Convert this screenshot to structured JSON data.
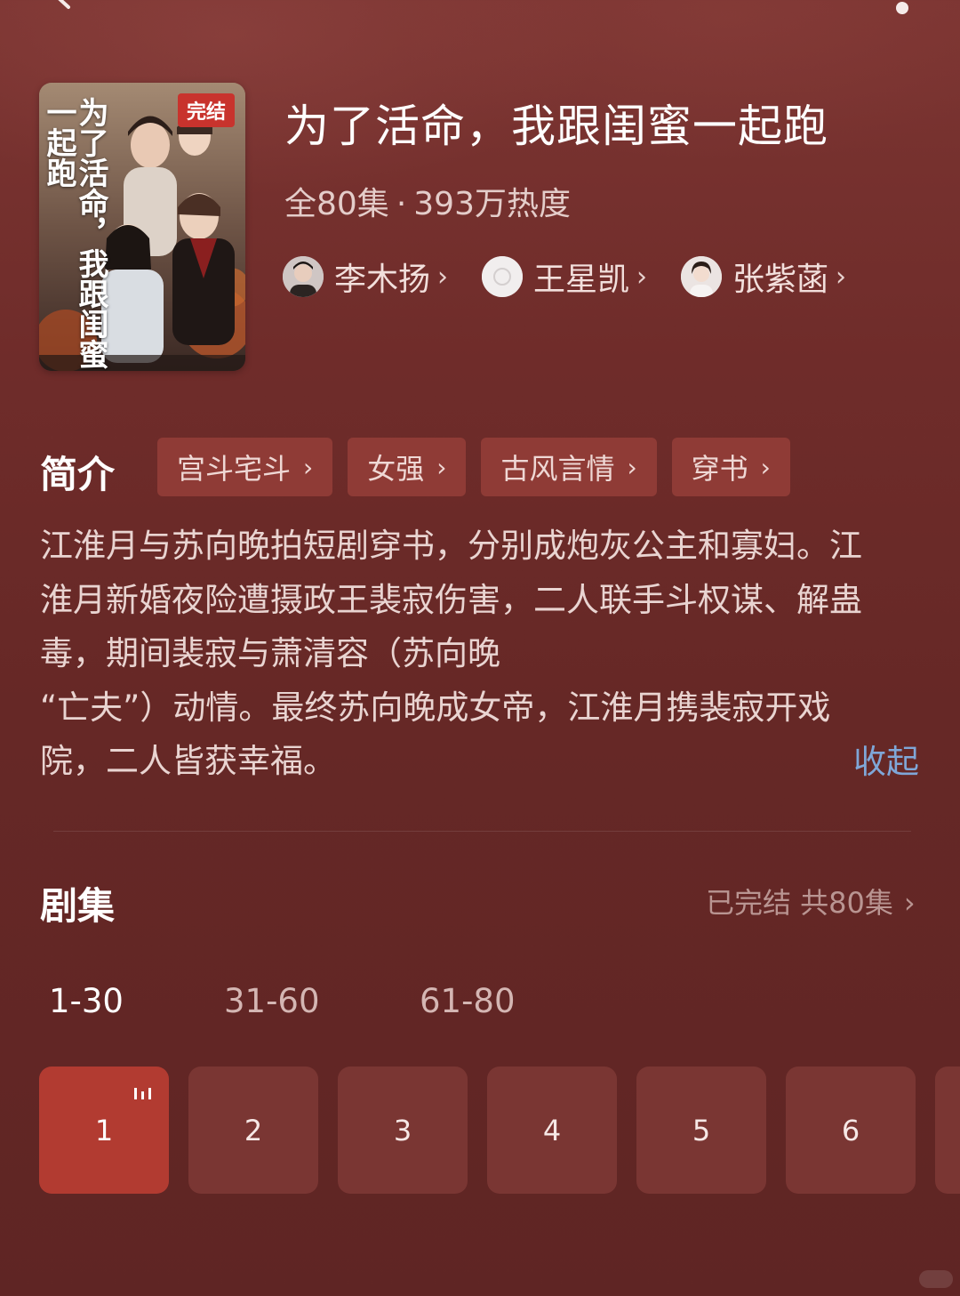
{
  "header": {
    "back_icon": "chevron-left-icon",
    "more_icon": "more-dots-icon"
  },
  "poster": {
    "badge": "完结",
    "title_art": "为了活命，我跟闺蜜一起跑"
  },
  "show": {
    "title": "为了活命，我跟闺蜜一起跑",
    "episodes_total": "全80集",
    "separator": "·",
    "popularity": "393万热度"
  },
  "actors": [
    {
      "name": "李木扬",
      "chevron": "›"
    },
    {
      "name": "王星凯",
      "chevron": "›"
    },
    {
      "name": "张紫菡",
      "chevron": "›"
    }
  ],
  "intro": {
    "label": "简介",
    "tags": [
      {
        "label": "宫斗宅斗",
        "chevron": "›"
      },
      {
        "label": "女强",
        "chevron": "›"
      },
      {
        "label": "古风言情",
        "chevron": "›"
      },
      {
        "label": "穿书",
        "chevron": "›"
      }
    ],
    "synopsis_lines": [
      "江淮月与苏向晚拍短剧穿书，分别成炮灰公主和寡妇。江",
      "淮月新婚夜险遭摄政王裴寂伤害，二人联手斗权谋、解蛊",
      "毒，期间裴寂与萧清容（苏向晚",
      "“亡夫”）动情。最终苏向晚成女帝，江淮月携裴寂开戏",
      "院，二人皆获幸福。"
    ],
    "collapse_label": "收起"
  },
  "episodes": {
    "label": "剧集",
    "status": "已完结 共80集",
    "status_chevron": "›",
    "ranges": [
      "1-30",
      "31-60",
      "61-80"
    ],
    "active_range": "1-30",
    "items": [
      "1",
      "2",
      "3",
      "4",
      "5",
      "6"
    ],
    "active_episode": "1"
  },
  "colors": {
    "background": "#6f2c2a",
    "tag_bg": "#8f3b36",
    "episode_bg": "#7a3633",
    "episode_active": "#b23b31",
    "link": "#7fa7d8"
  }
}
